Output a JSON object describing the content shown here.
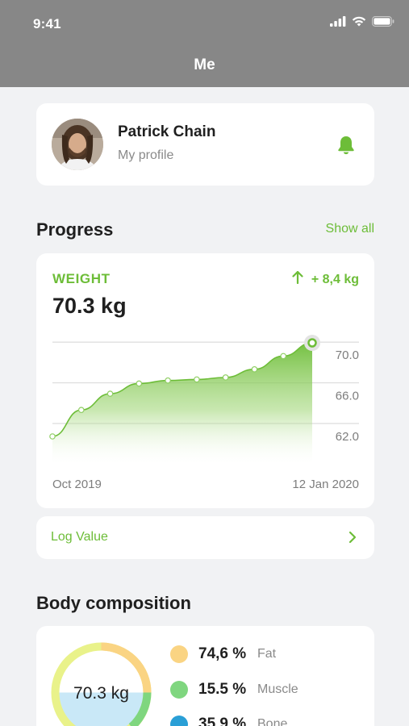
{
  "status_bar": {
    "time": "9:41"
  },
  "nav": {
    "title": "Me"
  },
  "profile": {
    "name": "Patrick Chain",
    "subtitle": "My profile"
  },
  "progress": {
    "title": "Progress",
    "show_all": "Show all",
    "metric_label": "WEIGHT",
    "current_value": "70.3 kg",
    "change": "+ 8,4 kg",
    "x_start_label": "Oct 2019",
    "x_end_label": "12 Jan 2020",
    "log_value": "Log Value"
  },
  "chart_data": {
    "type": "area",
    "title": "",
    "xlabel": "",
    "ylabel": "",
    "x_start": "Oct 2019",
    "x_end": "12 Jan 2020",
    "y_ticks": [
      "70.0",
      "66.0",
      "62.0"
    ],
    "ylim": [
      60.5,
      71.2
    ],
    "values": [
      62.0,
      64.6,
      66.2,
      67.2,
      67.5,
      67.6,
      67.8,
      68.6,
      69.9,
      71.2
    ],
    "area_color": "#6dbd38",
    "grid": true
  },
  "body_composition": {
    "title": "Body composition",
    "total": "70.3 kg",
    "items": [
      {
        "value": "74,6 %",
        "label": "Fat",
        "color": "#fad483"
      },
      {
        "value": "15.5 %",
        "label": "Muscle",
        "color": "#7fd67f"
      },
      {
        "value": "35.9 %",
        "label": "Bone",
        "color": "#2a9fd6"
      }
    ]
  },
  "colors": {
    "accent": "#6dbd38",
    "header": "#878787",
    "background": "#f1f2f4"
  }
}
